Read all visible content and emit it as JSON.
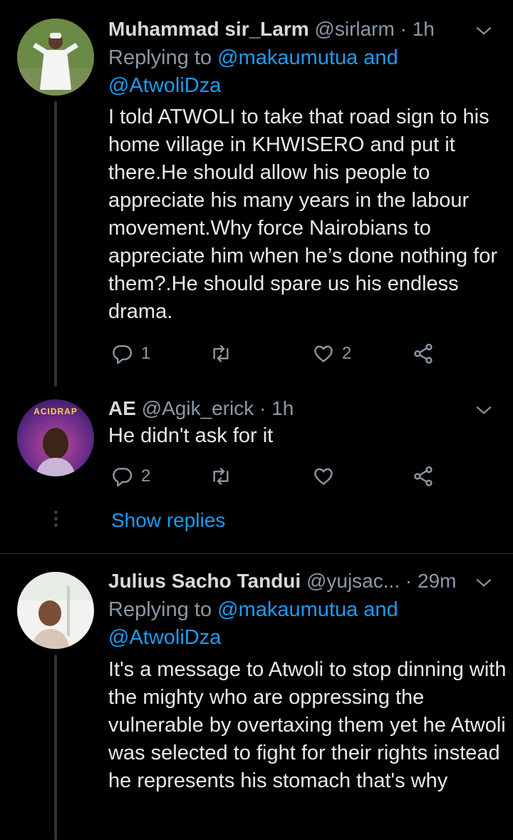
{
  "tweets": [
    {
      "name": "Muhammad sir_Larm",
      "handle": "@sirlarm",
      "time": "· 1h",
      "reply_prefix": "Replying to ",
      "reply_mention_1": "@makaumutua",
      "reply_and": " and",
      "reply_mention_2": "@AtwoliDza",
      "text": "I told ATWOLI to take that road sign to his home village in KHWISERO and put it there.He should allow his people to appreciate his many years in the labour movement.Why force Nairobians to appreciate him when he’s done nothing for them?.He should spare us his endless drama.",
      "reply_count": "1",
      "retweet_count": "",
      "like_count": "2"
    },
    {
      "name": "AE",
      "handle": "@Agik_erick",
      "time": "· 1h",
      "text": "He didn't ask for it",
      "reply_count": "2",
      "retweet_count": "",
      "like_count": "",
      "avatar_text": "ACIDRAP"
    },
    {
      "name": "Julius Sacho Tandui",
      "handle": "@yujsac...",
      "time": "· 29m",
      "reply_prefix": "Replying to ",
      "reply_mention_1": "@makaumutua",
      "reply_and": " and",
      "reply_mention_2": "@AtwoliDza",
      "text": "It's a message to Atwoli to stop dinning with the mighty who are oppressing the vulnerable by overtaxing them yet he Atwoli was selected to fight for their rights instead he represents his stomach that's why"
    }
  ],
  "show_replies_label": "Show replies",
  "icons": [
    "reply-icon",
    "retweet-icon",
    "like-icon",
    "share-icon",
    "chevron-down-icon"
  ],
  "colors": {
    "background": "#000000",
    "link": "#1d9bf0",
    "muted": "#8b98a5",
    "text": "#e7e9ea"
  }
}
